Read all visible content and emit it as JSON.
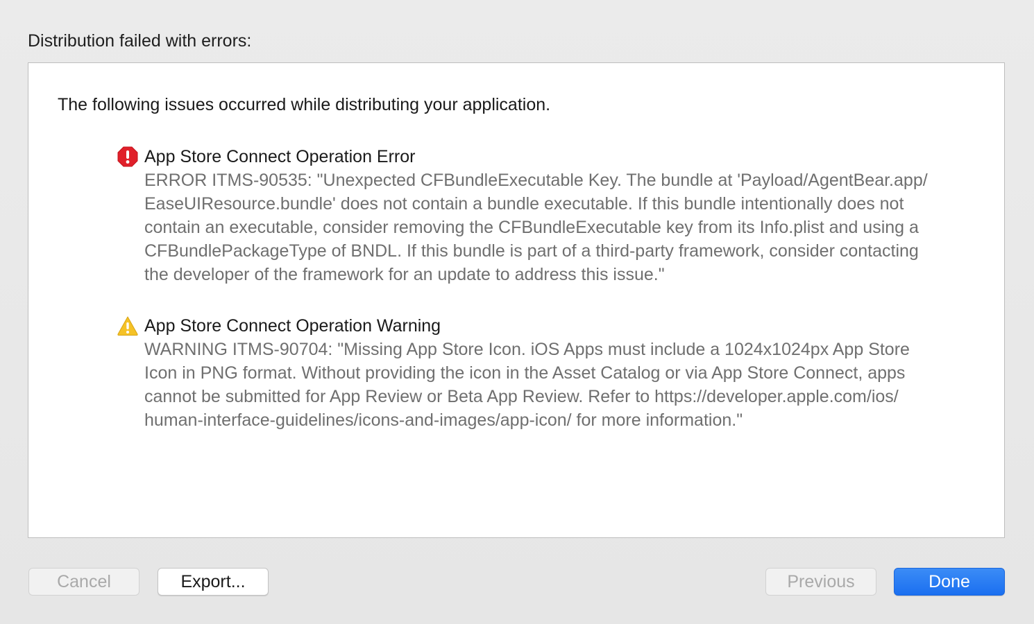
{
  "dialog": {
    "title": "Distribution failed with errors:",
    "intro": "The following issues occurred while distributing your application."
  },
  "issues": [
    {
      "type": "error",
      "icon": "error-octagon-icon",
      "color": "#e0202a",
      "title": "App Store Connect Operation Error",
      "lines": [
        "ERROR ITMS-90535: \"Unexpected CFBundleExecutable Key. The bundle at 'Payload/AgentBear.app/",
        "EaseUIResource.bundle' does not contain a bundle executable. If this bundle intentionally does not",
        "contain an executable, consider removing the CFBundleExecutable key from its Info.plist and using a",
        "CFBundlePackageType of BNDL. If this bundle is part of a third-party framework, consider contacting",
        "the developer of the framework for an update to address this issue.\""
      ]
    },
    {
      "type": "warning",
      "icon": "warning-triangle-icon",
      "color": "#f5c227",
      "title": "App Store Connect Operation Warning",
      "lines": [
        "WARNING ITMS-90704: \"Missing App Store Icon. iOS Apps must include a 1024x1024px App Store",
        "Icon in PNG format. Without providing the icon in the Asset Catalog or via App Store Connect, apps",
        "cannot be submitted for App Review or Beta App Review. Refer to https://developer.apple.com/ios/",
        "human-interface-guidelines/icons-and-images/app-icon/ for more information.\""
      ]
    }
  ],
  "buttons": {
    "cancel": "Cancel",
    "export": "Export...",
    "previous": "Previous",
    "done": "Done"
  },
  "colors": {
    "primary_button": "#1b6ff0",
    "background": "#ebebeb"
  }
}
